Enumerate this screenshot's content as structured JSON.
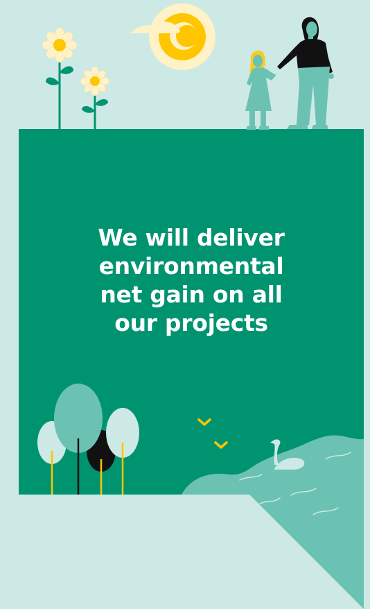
{
  "headline": {
    "lines": [
      "We will deliver",
      "environmental",
      "net gain on all",
      "our projects"
    ]
  },
  "colors": {
    "background": "#cde9e5",
    "panel": "#009370",
    "water": "#6cc2b2",
    "tree_light": "#cde9e5",
    "tree_mid": "#6cc2b2",
    "sun": "#ffc600",
    "sun_halo": "#fff2c6",
    "dark": "#111111",
    "text": "#ffffff"
  }
}
